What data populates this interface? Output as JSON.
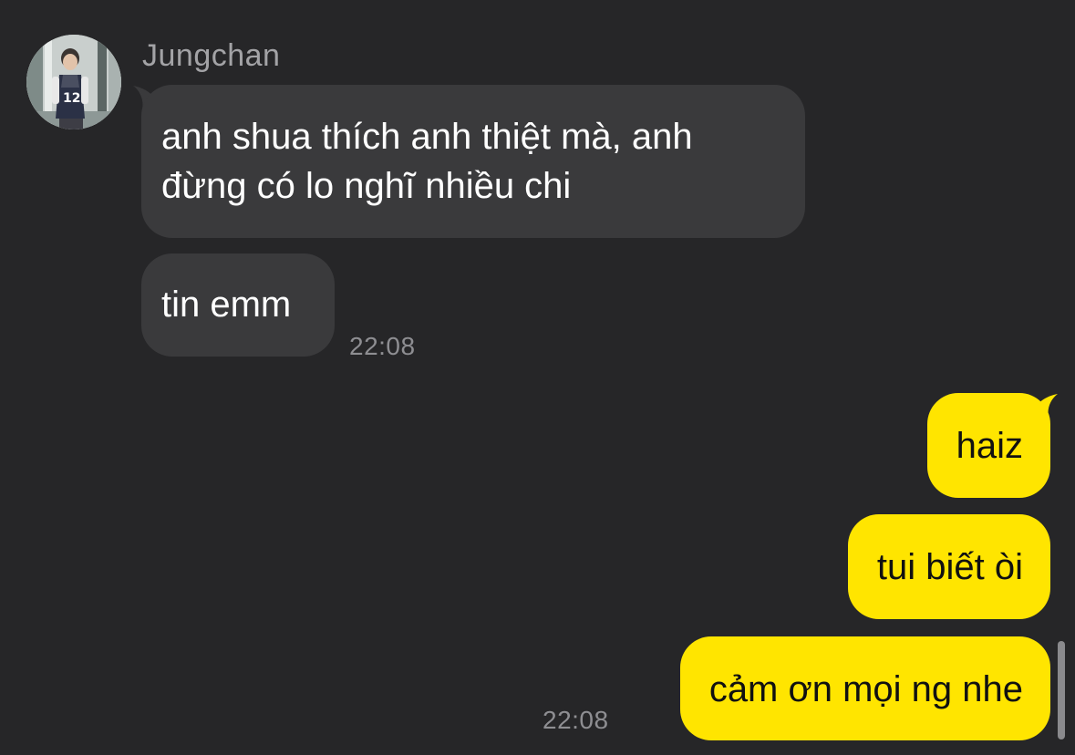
{
  "conversation": {
    "contact_name": "Jungchan",
    "incoming": [
      {
        "text_line1": "anh shua thích anh thiệt mà, anh",
        "text_line2": "đừng có lo nghĩ nhiều chi"
      },
      {
        "text": "tin emm"
      }
    ],
    "incoming_time": "22:08",
    "outgoing": [
      {
        "text": "haiz"
      },
      {
        "text": "tui biết òi"
      },
      {
        "text": "cảm ơn mọi ng nhe"
      }
    ],
    "outgoing_time": "22:08"
  },
  "theme": {
    "background": "#262628",
    "incoming_bubble": "#3a3a3c",
    "outgoing_bubble": "#ffe500",
    "timestamp_color": "#8e8e92"
  },
  "icons": {
    "avatar": "profile-photo"
  }
}
